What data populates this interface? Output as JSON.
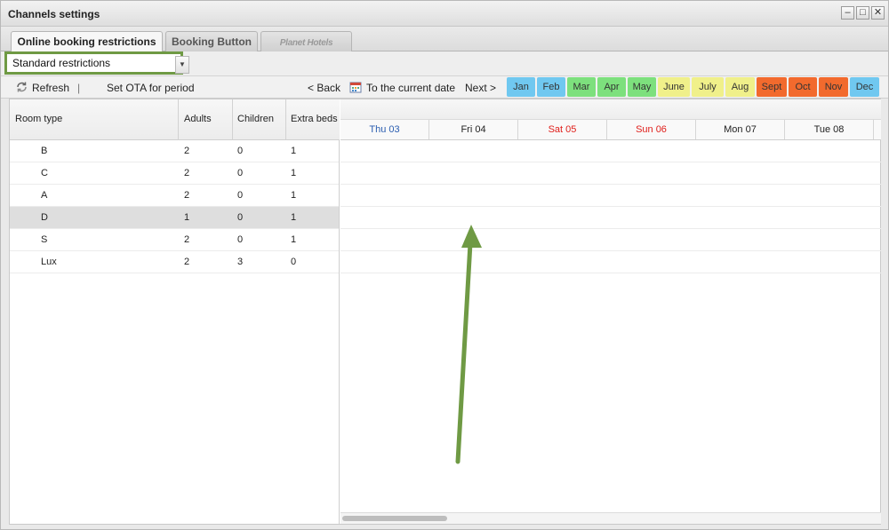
{
  "window": {
    "title": "Channels settings"
  },
  "tabs": [
    {
      "label": "Online booking restrictions"
    },
    {
      "label": "Booking Button"
    },
    {
      "label": "Planet Hotels"
    }
  ],
  "restriction_select": {
    "value": "Standard restrictions"
  },
  "toolbar": {
    "refresh_label": "Refresh",
    "separator": "|",
    "set_ota_label": "Set OTA for period",
    "back_label": "< Back",
    "current_date_label": "To the current date",
    "next_label": "Next >"
  },
  "months": [
    {
      "label": "Jan",
      "color": "#70c8f0"
    },
    {
      "label": "Feb",
      "color": "#70c8f0"
    },
    {
      "label": "Mar",
      "color": "#7de07d"
    },
    {
      "label": "Apr",
      "color": "#7de07d"
    },
    {
      "label": "May",
      "color": "#7de07d"
    },
    {
      "label": "June",
      "color": "#f0f08a"
    },
    {
      "label": "July",
      "color": "#f0f08a"
    },
    {
      "label": "Aug",
      "color": "#f0f08a"
    },
    {
      "label": "Sept",
      "color": "#f26a2d"
    },
    {
      "label": "Oct",
      "color": "#f26a2d"
    },
    {
      "label": "Nov",
      "color": "#f26a2d"
    },
    {
      "label": "Dec",
      "color": "#70c8f0"
    }
  ],
  "table": {
    "headers": {
      "room_type": "Room type",
      "adults": "Adults",
      "children": "Children",
      "extra_beds": "Extra beds"
    },
    "rows": [
      {
        "room": "B",
        "adults": "2",
        "children": "0",
        "extra": "1"
      },
      {
        "room": "C",
        "adults": "2",
        "children": "0",
        "extra": "1"
      },
      {
        "room": "A",
        "adults": "2",
        "children": "0",
        "extra": "1"
      },
      {
        "room": "D",
        "adults": "1",
        "children": "0",
        "extra": "1"
      },
      {
        "room": "S",
        "adults": "2",
        "children": "0",
        "extra": "1"
      },
      {
        "room": "Lux",
        "adults": "2",
        "children": "3",
        "extra": "0"
      }
    ]
  },
  "days": [
    {
      "label": "Thu 03",
      "color": "#2a5db0"
    },
    {
      "label": "Fri 04",
      "color": "#222222"
    },
    {
      "label": "Sat 05",
      "color": "#e0201c"
    },
    {
      "label": "Sun 06",
      "color": "#e0201c"
    },
    {
      "label": "Mon 07",
      "color": "#222222"
    },
    {
      "label": "Tue 08",
      "color": "#222222"
    }
  ],
  "colors": {
    "highlight": "#6f9a44",
    "selected_row": "#dedede"
  }
}
